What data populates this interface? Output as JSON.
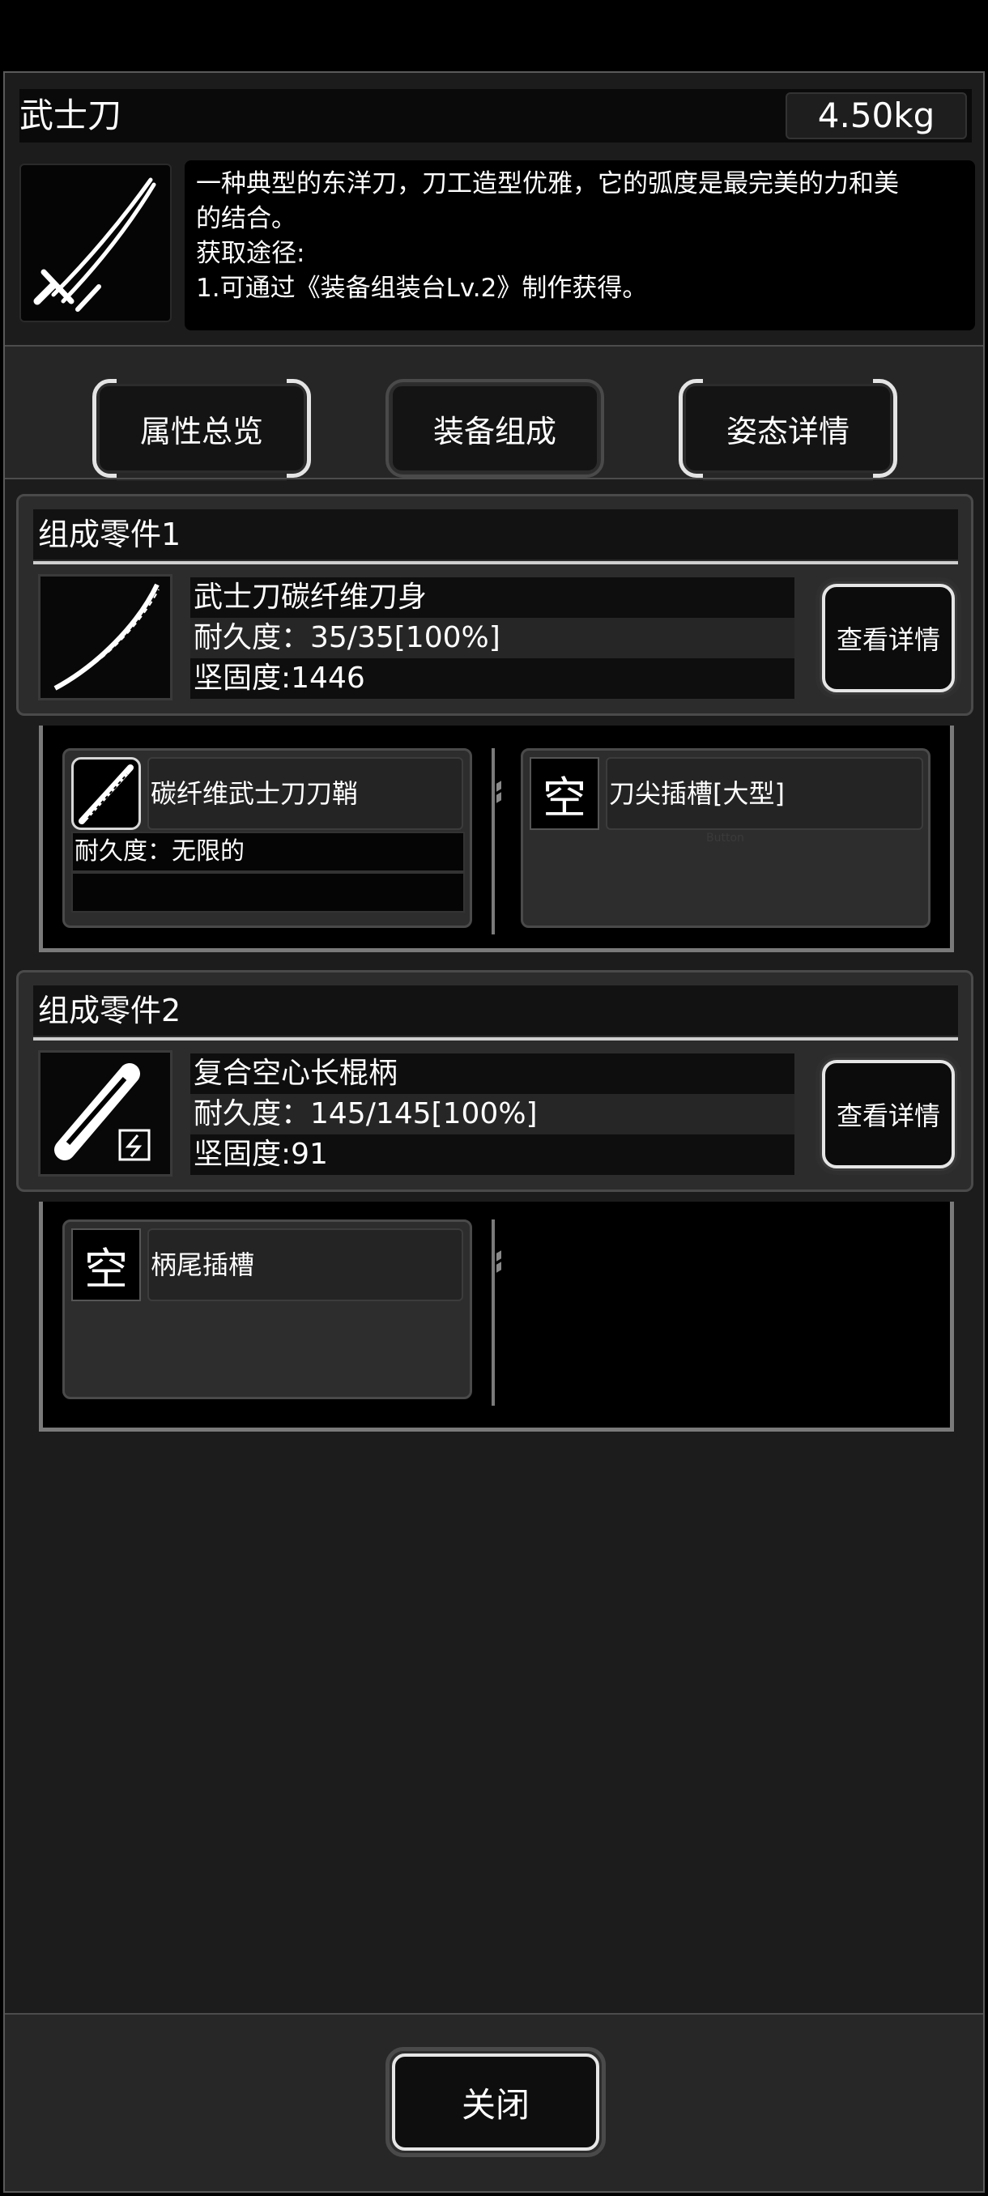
{
  "item": {
    "name": "武士刀",
    "weight": "4.50kg",
    "icon": "katana-icon",
    "description_lines": [
      "一种典型的东洋刀，刀工造型优雅，它的弧度是最完美的力和美",
      "的结合。",
      "获取途径:",
      "1.可通过《装备组装台Lv.2》制作获得。"
    ]
  },
  "tabs": [
    {
      "label": "属性总览"
    },
    {
      "label": "装备组成"
    },
    {
      "label": "姿态详情"
    }
  ],
  "parts": [
    {
      "title": "组成零件1",
      "icon": "blade-icon",
      "name": "武士刀碳纤维刀身",
      "durability": "耐久度：35/35[100%]",
      "hardness": "坚固度:1446",
      "detail_label": "查看详情",
      "slots": [
        {
          "icon": "scabbard-icon",
          "name": "碳纤维武士刀刀鞘",
          "line1": "耐久度：无限的",
          "line2": ""
        },
        {
          "icon_text": "空",
          "name": "刀尖插槽[大型]",
          "ghost": "Button"
        }
      ]
    },
    {
      "title": "组成零件2",
      "icon": "handle-icon",
      "name": "复合空心长棍柄",
      "durability": "耐久度：145/145[100%]",
      "hardness": "坚固度:91",
      "detail_label": "查看详情",
      "slots": [
        {
          "icon_text": "空",
          "name": "柄尾插槽"
        }
      ]
    }
  ],
  "footer": {
    "close_label": "关闭"
  }
}
